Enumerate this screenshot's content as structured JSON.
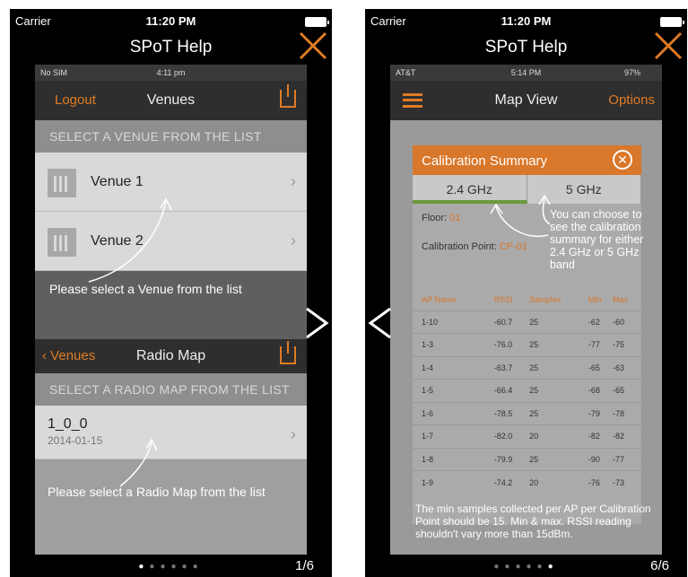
{
  "left": {
    "status": {
      "carrier": "Carrier",
      "time": "11:20 PM"
    },
    "title": "SPoT Help",
    "mini_status": {
      "carrier": "No SIM",
      "time": "4:11 pm"
    },
    "venues_nav": {
      "left": "Logout",
      "title": "Venues"
    },
    "venue_header": "SELECT A VENUE FROM THE LIST",
    "venues": [
      "Venue 1",
      "Venue 2"
    ],
    "venue_hint": "Please select a Venue from the list",
    "radio_nav": {
      "back": "Venues",
      "title": "Radio Map"
    },
    "radio_header": "SELECT A RADIO MAP FROM THE LIST",
    "radio_item": {
      "name": "1_0_0",
      "date": "2014-01-15"
    },
    "radio_hint": "Please select a Radio Map from the list",
    "page": "1/6"
  },
  "right": {
    "status": {
      "carrier": "Carrier",
      "time": "11:20 PM"
    },
    "title": "SPoT Help",
    "mini_status": {
      "carrier": "AT&T",
      "time": "5:14 PM",
      "battery": "97%"
    },
    "nav": {
      "title": "Map View",
      "options": "Options"
    },
    "modal": {
      "title": "Calibration Summary",
      "tabs": [
        "2.4 GHz",
        "5 GHz"
      ],
      "floor_label": "Floor:",
      "floor_value": "01",
      "point_label": "Calibration Point:",
      "point_value": "CP-01",
      "columns": [
        "AP Name",
        "RSSI",
        "Samples",
        "Min",
        "Max"
      ],
      "rows": [
        [
          "1-10",
          "-60.7",
          "25",
          "-62",
          "-60"
        ],
        [
          "1-3",
          "-76.0",
          "25",
          "-77",
          "-75"
        ],
        [
          "1-4",
          "-63.7",
          "25",
          "-65",
          "-63"
        ],
        [
          "1-5",
          "-66.4",
          "25",
          "-68",
          "-65"
        ],
        [
          "1-6",
          "-78.5",
          "25",
          "-79",
          "-78"
        ],
        [
          "1-7",
          "-82.0",
          "20",
          "-82",
          "-82"
        ],
        [
          "1-8",
          "-79.9",
          "25",
          "-90",
          "-77"
        ],
        [
          "1-9",
          "-74.2",
          "20",
          "-76",
          "-73"
        ]
      ]
    },
    "tab_hint": "You can choose to see the calibration summary for either 2.4 GHz or 5 GHz band",
    "bottom_hint": "The min samples collected per AP per Calibration Point should be 15. Min & max. RSSI reading shouldn't vary more than 15dBm.",
    "page": "6/6"
  },
  "colors": {
    "accent": "#e07b24",
    "green": "#6a9a3a"
  },
  "icons": {
    "close": "close-x-icon",
    "next": "chevron-right-icon",
    "prev": "chevron-left-icon"
  }
}
